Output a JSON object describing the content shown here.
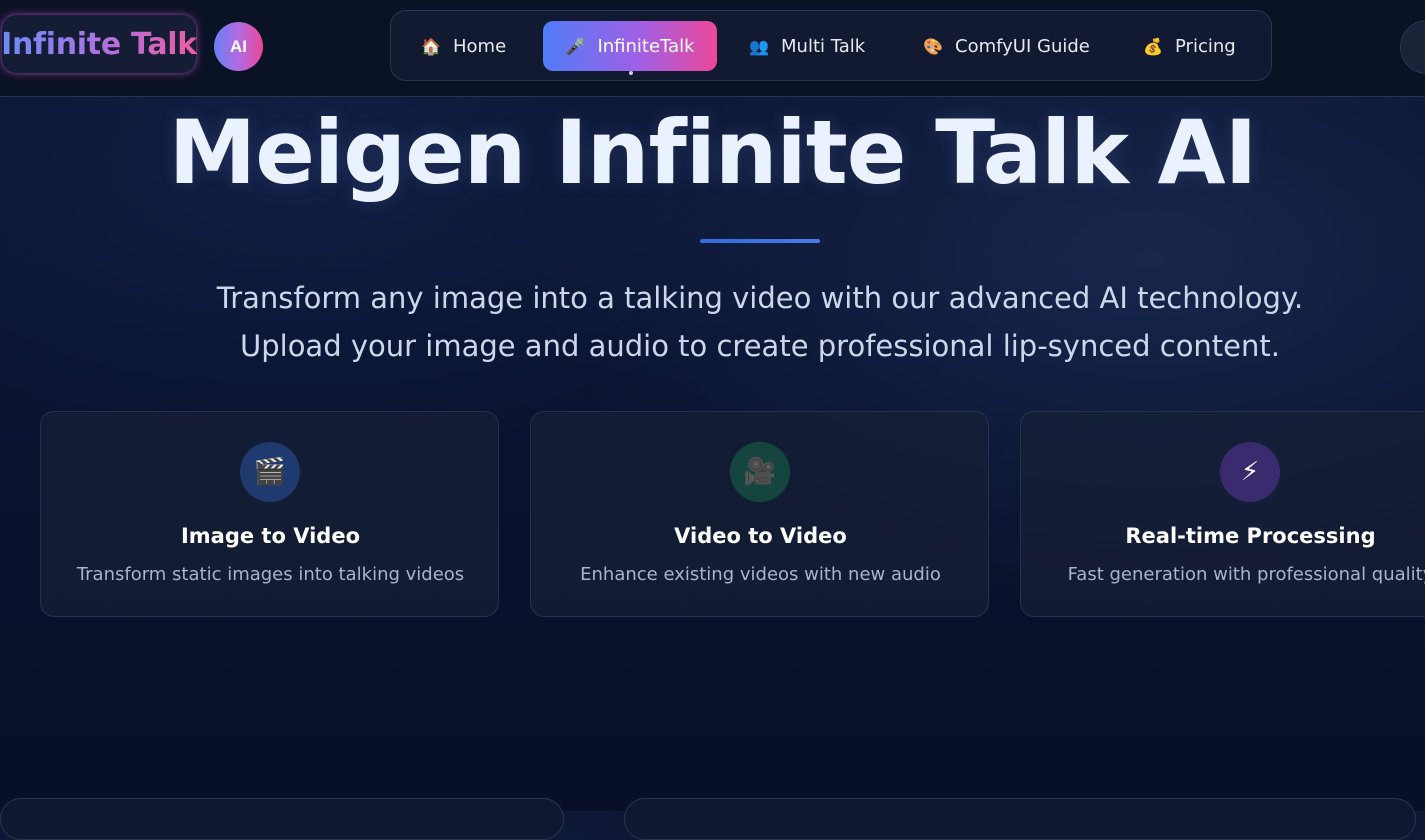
{
  "header": {
    "logo_text": "Infinite Talk",
    "ai_badge": "AI",
    "nav": [
      {
        "label": "Home",
        "icon": "house-icon",
        "glyph": "🏠",
        "active": false
      },
      {
        "label": "InfiniteTalk",
        "icon": "microphone-icon",
        "glyph": "🎤",
        "active": true
      },
      {
        "label": "Multi Talk",
        "icon": "people-icon",
        "glyph": "👥",
        "active": false
      },
      {
        "label": "ComfyUI Guide",
        "icon": "palette-icon",
        "glyph": "🎨",
        "active": false
      },
      {
        "label": "Pricing",
        "icon": "money-bag-icon",
        "glyph": "💰",
        "active": false
      }
    ]
  },
  "hero": {
    "title": "Meigen Infinite Talk AI",
    "subtitle_line1": "Transform any image into a talking video with our advanced AI technology.",
    "subtitle_line2": "Upload your image and audio to create professional lip-synced content."
  },
  "features": [
    {
      "title": "Image to Video",
      "description": "Transform static images into talking videos",
      "icon": "clapperboard-icon",
      "glyph": "🎬",
      "icon_bg": "#1e3a6e"
    },
    {
      "title": "Video to Video",
      "description": "Enhance existing videos with new audio",
      "icon": "video-camera-icon",
      "glyph": "🎥",
      "icon_bg": "#14463f"
    },
    {
      "title": "Real-time Processing",
      "description": "Fast generation with professional quality",
      "icon": "lightning-icon",
      "glyph": "⚡",
      "icon_bg": "#3a2a6e"
    }
  ],
  "colors": {
    "accent_gradient_start": "#4f7cf7",
    "accent_gradient_end": "#ec4899",
    "background": "#0a1330"
  }
}
